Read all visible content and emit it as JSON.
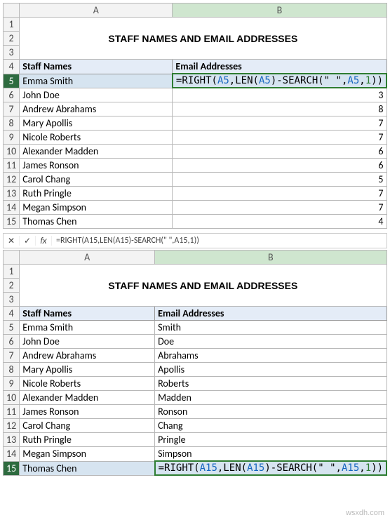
{
  "sheet1": {
    "title": "STAFF NAMES AND EMAIL ADDRESSES",
    "headers": {
      "a": "Staff Names",
      "b": "Email Addresses"
    },
    "cols": [
      "A",
      "B"
    ],
    "row_nums": [
      "1",
      "2",
      "3",
      "4",
      "5",
      "6",
      "7",
      "8",
      "9",
      "10",
      "11",
      "12",
      "13",
      "14",
      "15"
    ],
    "active_row": "5",
    "active_formula": {
      "pre": "=RIGHT(",
      "a": "A5",
      "mid1": ",LEN(",
      "a2": "A5",
      "mid2": ")-SEARCH(\" \"",
      "comma": ",",
      "a3": "A5",
      "comma2": ",",
      "one": "1",
      "close": "))"
    },
    "rows": [
      {
        "a": "Emma Smith",
        "b_formula": true
      },
      {
        "a": "John Doe",
        "b": "3"
      },
      {
        "a": "Andrew Abrahams",
        "b": "8"
      },
      {
        "a": "Mary Apollis",
        "b": "7"
      },
      {
        "a": "Nicole Roberts",
        "b": "7"
      },
      {
        "a": "Alexander Madden",
        "b": "6"
      },
      {
        "a": "James Ronson",
        "b": "6"
      },
      {
        "a": "Carol Chang",
        "b": "5"
      },
      {
        "a": "Ruth Pringle",
        "b": "7"
      },
      {
        "a": "Megan Simpson",
        "b": "7"
      },
      {
        "a": "Thomas Chen",
        "b": "4"
      }
    ]
  },
  "formula_bar": {
    "cancel": "✕",
    "enter": "✓",
    "fx": "fx",
    "text": "=RIGHT(A15,LEN(A15)-SEARCH(\" \",A15,1))"
  },
  "sheet2": {
    "title": "STAFF NAMES AND EMAIL ADDRESSES",
    "headers": {
      "a": "Staff Names",
      "b": "Email Addresses"
    },
    "cols": [
      "A",
      "B"
    ],
    "row_nums": [
      "1",
      "2",
      "3",
      "4",
      "5",
      "6",
      "7",
      "8",
      "9",
      "10",
      "11",
      "12",
      "13",
      "14",
      "15"
    ],
    "active_row": "15",
    "active_formula": {
      "pre": "=RIGHT(",
      "a": "A15",
      "mid1": ",LEN(",
      "a2": "A15",
      "mid2": ")-SEARCH(\" \"",
      "comma": ",",
      "a3": "A15",
      "comma2": ",",
      "one": "1",
      "close": "))"
    },
    "rows": [
      {
        "a": "Emma Smith",
        "b": "Smith"
      },
      {
        "a": "John Doe",
        "b": "Doe"
      },
      {
        "a": "Andrew Abrahams",
        "b": "Abrahams"
      },
      {
        "a": "Mary Apollis",
        "b": "Apollis"
      },
      {
        "a": "Nicole Roberts",
        "b": "Roberts"
      },
      {
        "a": "Alexander Madden",
        "b": "Madden"
      },
      {
        "a": "James Ronson",
        "b": "Ronson"
      },
      {
        "a": "Carol Chang",
        "b": "Chang"
      },
      {
        "a": "Ruth Pringle",
        "b": "Pringle"
      },
      {
        "a": "Megan Simpson",
        "b": "Simpson"
      },
      {
        "a": "Thomas Chen",
        "b_formula": true
      }
    ]
  },
  "watermark": "wsxdh.com",
  "chart_data": {
    "type": "table",
    "title": "STAFF NAMES AND EMAIL ADDRESSES",
    "sheet1": {
      "columns": [
        "Staff Names",
        "Email Addresses"
      ],
      "rows": [
        [
          "Emma Smith",
          "=RIGHT(A5,LEN(A5)-SEARCH(\" \",A5,1))"
        ],
        [
          "John Doe",
          3
        ],
        [
          "Andrew Abrahams",
          8
        ],
        [
          "Mary Apollis",
          7
        ],
        [
          "Nicole Roberts",
          7
        ],
        [
          "Alexander Madden",
          6
        ],
        [
          "James Ronson",
          6
        ],
        [
          "Carol Chang",
          5
        ],
        [
          "Ruth Pringle",
          7
        ],
        [
          "Megan Simpson",
          7
        ],
        [
          "Thomas Chen",
          4
        ]
      ]
    },
    "sheet2": {
      "columns": [
        "Staff Names",
        "Email Addresses"
      ],
      "rows": [
        [
          "Emma Smith",
          "Smith"
        ],
        [
          "John Doe",
          "Doe"
        ],
        [
          "Andrew Abrahams",
          "Abrahams"
        ],
        [
          "Mary Apollis",
          "Apollis"
        ],
        [
          "Nicole Roberts",
          "Roberts"
        ],
        [
          "Alexander Madden",
          "Madden"
        ],
        [
          "James Ronson",
          "Ronson"
        ],
        [
          "Carol Chang",
          "Chang"
        ],
        [
          "Ruth Pringle",
          "Pringle"
        ],
        [
          "Megan Simpson",
          "Simpson"
        ],
        [
          "Thomas Chen",
          "=RIGHT(A15,LEN(A15)-SEARCH(\" \",A15,1))"
        ]
      ]
    }
  }
}
